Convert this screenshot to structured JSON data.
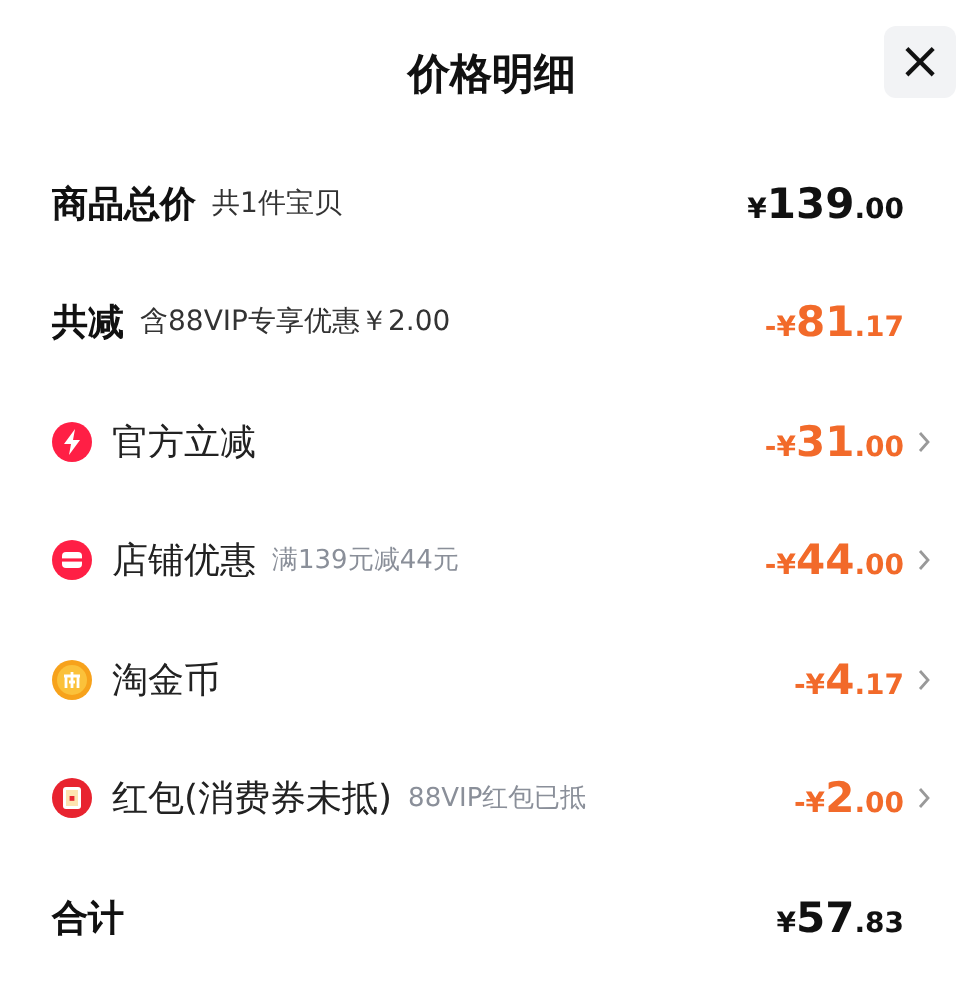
{
  "title": "价格明细",
  "close": "×",
  "rows": [
    {
      "kind": "total",
      "label": "商品总价",
      "note": "共1件宝贝",
      "amount": "¥139.00"
    },
    {
      "kind": "reduction",
      "label": "共减",
      "note": "含88VIP专享优惠￥2.00",
      "amount": "-¥81.17"
    },
    {
      "kind": "flash",
      "label": "官方立减",
      "amount": "-¥31.00"
    },
    {
      "kind": "store",
      "label": "店铺优惠",
      "note": "满139元减44元",
      "amount": "-¥44.00"
    },
    {
      "kind": "coin",
      "label": "淘金币",
      "amount": "-¥4.17"
    },
    {
      "kind": "packet",
      "label": "红包(消费券未抵)",
      "note": "88VIP红包已抵",
      "amount": "-¥2.00"
    },
    {
      "kind": "total",
      "label": "合计",
      "amount": "¥57.83"
    }
  ]
}
